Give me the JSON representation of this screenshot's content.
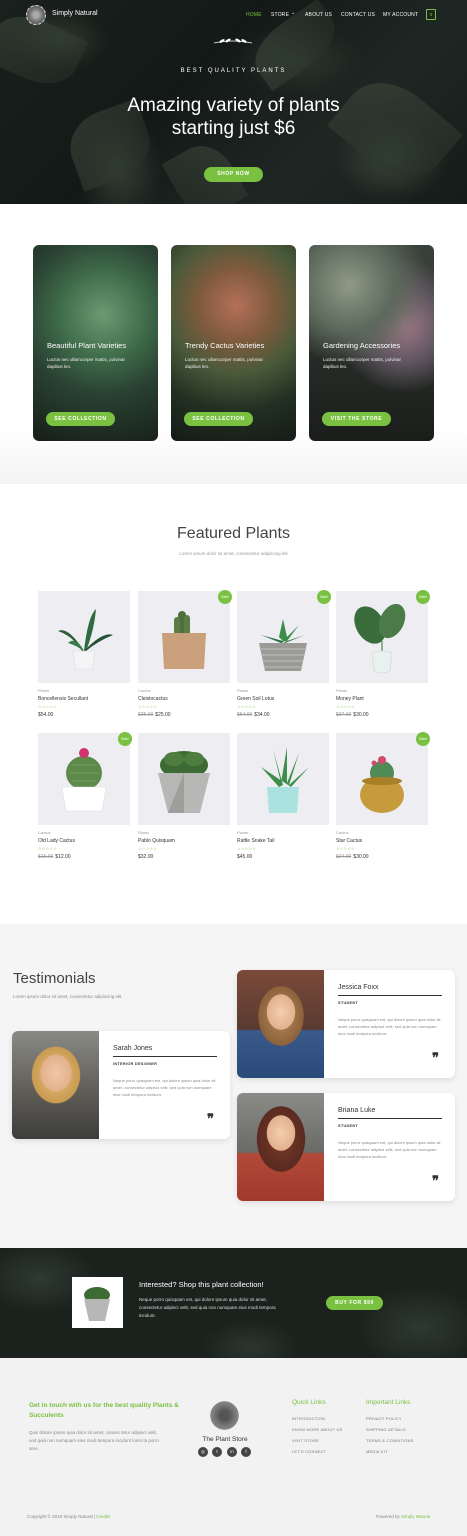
{
  "nav": {
    "logo_text": "Simply Natural",
    "items": [
      "HOME",
      "STORE",
      "ABOUT US",
      "CONTACT US",
      "MY ACCOUNT"
    ],
    "store_chevron": "⌄",
    "cart_count": "0"
  },
  "hero": {
    "eyebrow": "BEST QUALITY PLANTS",
    "title_line1": "Amazing variety of plants",
    "title_line2": "starting just $6",
    "button": "SHOP NOW"
  },
  "collections": [
    {
      "title": "Beautiful Plant Varieties",
      "desc": "Luctus nec ullamcorper mattis, pulvinar dapibus leo.",
      "button": "SEE COLLECTION"
    },
    {
      "title": "Trendy Cactus Varieties",
      "desc": "Luctus nec ullamcorper mattis, pulvinar dapibus leo.",
      "button": "SEE COLLECTION"
    },
    {
      "title": "Gardening Accessories",
      "desc": "Luctus nec ullamcorper mattis, pulvinar dapibus leo.",
      "button": "VISIT THE STORE"
    }
  ],
  "featured": {
    "title": "Featured Plants",
    "subtitle": "Lorem ipsum dolor sit amet, consectetur adipiscing elit",
    "sale_label": "Sale!",
    "stars": "☆☆☆☆☆",
    "products": [
      {
        "category": "Plants",
        "name": "Boncellensis Secullant",
        "old_price": "",
        "price": "$54.00",
        "sale": false
      },
      {
        "category": "Cactus",
        "name": "Cleistocactus",
        "old_price": "$35.00",
        "price": "$25.00",
        "sale": true
      },
      {
        "category": "Plants",
        "name": "Green Soil Lotus",
        "old_price": "$54.00",
        "price": "$34.00",
        "sale": true
      },
      {
        "category": "Plants",
        "name": "Money Plant",
        "old_price": "$37.00",
        "price": "$30.00",
        "sale": true
      },
      {
        "category": "Cactus",
        "name": "Old Lady Cactus",
        "old_price": "$15.00",
        "price": "$12.00",
        "sale": true
      },
      {
        "category": "Plants",
        "name": "Pablo Quisquam",
        "old_price": "",
        "price": "$32.00",
        "sale": false
      },
      {
        "category": "Plants",
        "name": "Rattle Snake Tail",
        "old_price": "",
        "price": "$45.00",
        "sale": false
      },
      {
        "category": "Cactus",
        "name": "Star Cactus",
        "old_price": "$34.00",
        "price": "$30.00",
        "sale": true
      }
    ]
  },
  "testimonials": {
    "title": "Testimonials",
    "subtitle": "Lorem ipsum dolor sit amet, consectetur adipiscing elit",
    "quote_icon": "❞",
    "items": [
      {
        "name": "Sarah Jones",
        "role": "INTERIOR DESIGNER",
        "text": "Neque porro quisquam est, qui dolore ipsum quia dolor sit amet, consectetur adipisci velit, sed quia non numquam eius modi tempora incidunt."
      },
      {
        "name": "Jessica Foxx",
        "role": "STUDENT",
        "text": "Neque porro quisquam est, qui dolore ipsum quia dolor sit amet, consectetur adipisci velit, sed quia non numquam eius modi tempora incidunt."
      },
      {
        "name": "Briana Luke",
        "role": "STUDENT",
        "text": "Neque porro quisquam est, qui dolore ipsum quia dolor sit amet, consectetur adipisci velit, sed quia non numquam eius modi tempora incidunt."
      }
    ]
  },
  "shop_banner": {
    "title": "Interested? Shop this plant collection!",
    "text": "Neque porro quisquam est, qui dolore ipsum quia dolor sit amet, consectetur adipisci velit, sed quia non numquam eius modi tempora incidunt.",
    "button": "BUY FOR $99"
  },
  "footer": {
    "heading": "Get in touch with us for the best quality Plants & Succulents",
    "text": "Quis dolore ipsum quia dolor sit amet, consec tetur adipisci velit, sed quia non numquam eius modi tempora incidunt lores ta porro ame.",
    "store_name": "The Plant Store",
    "social": [
      "◎",
      "t",
      "in",
      "f"
    ],
    "quick_links_title": "Quick Links",
    "quick_links": [
      "INTRODUCTION",
      "KNOW MORE ABOUT US",
      "VISIT STORE",
      "LET'S CONNECT"
    ],
    "important_links_title": "Important Links",
    "important_links": [
      "PRIVACY POLICY",
      "SHIPPING DETAILS",
      "TERMS & CONDITIONS",
      "MEDIA KIT"
    ],
    "copyright_prefix": "Copyright © 2019 Simply Natural | ",
    "copyright_link": "Credits",
    "powered_prefix": "Powered by ",
    "powered_link": "Simply Natural"
  },
  "colors": {
    "accent": "#7ac142",
    "dark": "#1b221e"
  }
}
